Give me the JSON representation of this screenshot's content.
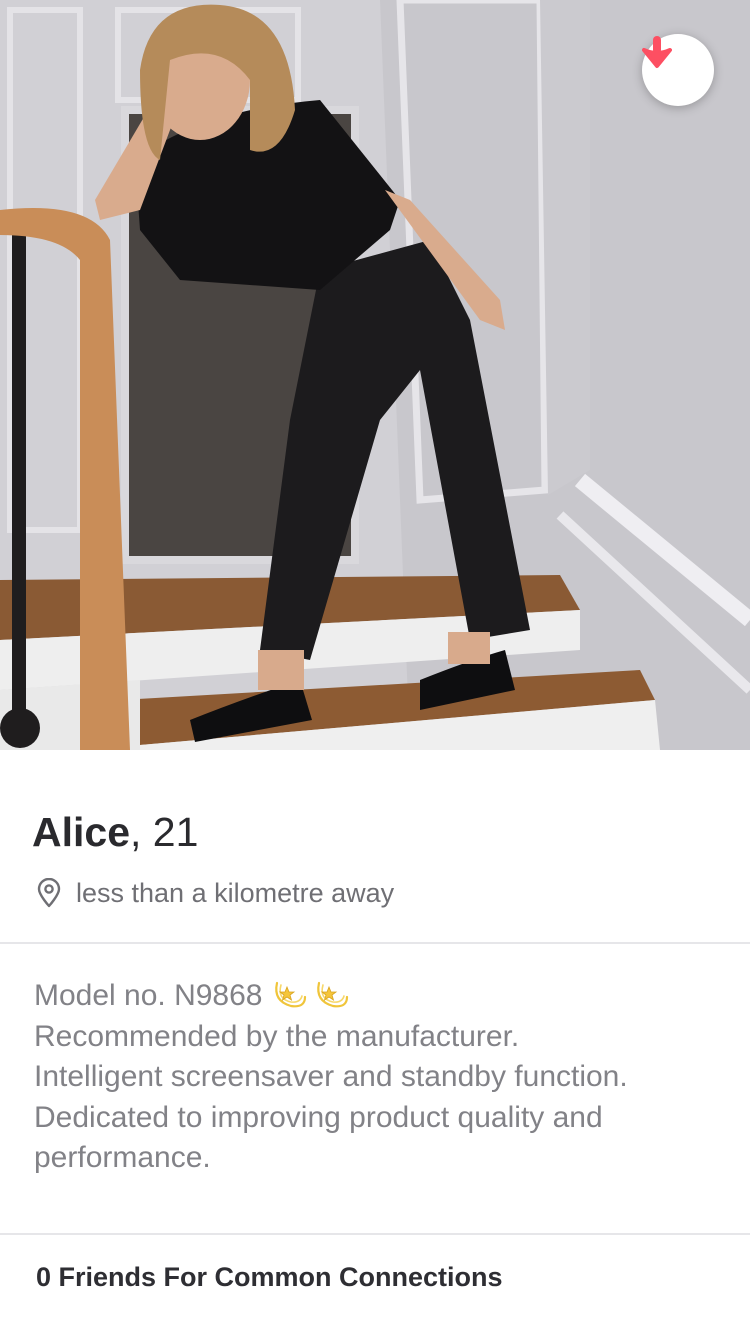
{
  "profile": {
    "name": "Alice",
    "age_text": ", 21",
    "distance": "less than a kilometre away"
  },
  "bio": {
    "lines": [
      "Model no. N9868",
      "Recommended by the manufacturer.",
      "Intelligent screensaver and standby function.",
      "Dedicated to improving product quality and",
      "performance."
    ],
    "emoji": [
      "dizzy-star",
      "dizzy-star"
    ]
  },
  "friends": {
    "text": "0 Friends For Common Connections"
  },
  "colors": {
    "accent": "#fd4f62",
    "name_text": "#2a2a2e",
    "secondary_text": "#6f6f74",
    "bio_text": "#828287",
    "divider": "#e6e6e9"
  },
  "icons": {
    "collapse": "arrow-down-icon",
    "location": "location-pin-icon"
  }
}
